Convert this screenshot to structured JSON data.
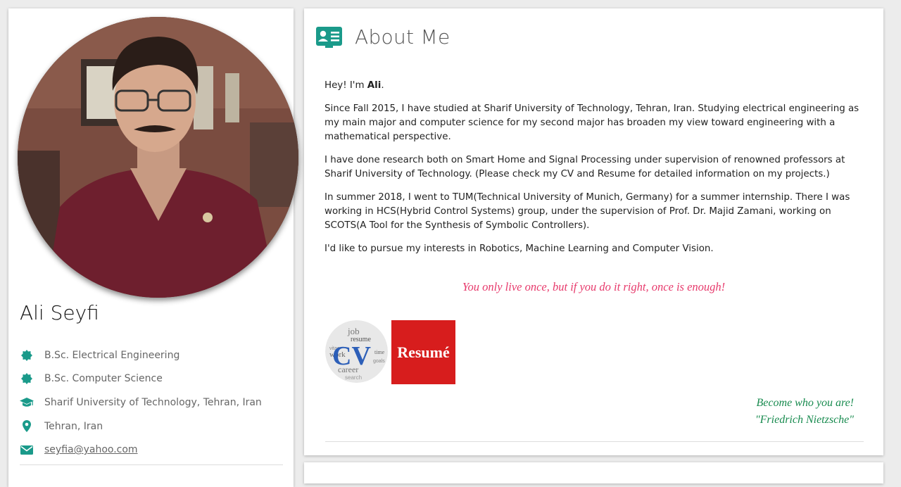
{
  "profile": {
    "name": "Ali Seyfi",
    "items": [
      {
        "icon": "badge-icon",
        "text": "B.Sc. Electrical Engineering"
      },
      {
        "icon": "badge-icon",
        "text": "B.Sc. Computer Science"
      },
      {
        "icon": "graduation-cap-icon",
        "text": "Sharif University of Technology, Tehran, Iran"
      },
      {
        "icon": "location-pin-icon",
        "text": "Tehran, Iran"
      },
      {
        "icon": "envelope-icon",
        "text": "seyfia@yahoo.com"
      }
    ]
  },
  "about": {
    "title": "About Me",
    "greeting_prefix": "Hey! I'm ",
    "greeting_name": "Ali",
    "greeting_suffix": ".",
    "paragraphs": [
      "Since Fall 2015, I have studied at Sharif University of Technology, Tehran, Iran. Studying electrical engineering as my main major and computer science for my second major has broaden my view toward engineering with a mathematical perspective.",
      "I have done research both on Smart Home and Signal Processing under supervision of renowned professors at Sharif University of Technology. (Please check my CV and Resume for detailed information on my projects.)",
      "In summer 2018, I went to TUM(Technical University of Munich, Germany) for a summer internship. There I was working in HCS(Hybrid Control Systems) group, under the supervision of Prof. Dr. Majid Zamani, working on SCOTS(A Tool for the Synthesis of Symbolic Controllers).",
      "I'd like to pursue my interests in Robotics, Machine Learning and Computer Vision."
    ],
    "quote": "You only live once, but if you do it right, once is enough!",
    "cv_label": "CV",
    "cv_words": [
      "job",
      "resume",
      "vitae",
      "work",
      "time",
      "career",
      "goals",
      "search"
    ],
    "resume_label": "Resumé",
    "nietzsche_quote": "Become who you are!",
    "nietzsche_author": "\"Friedrich Nietzsche\""
  },
  "colors": {
    "accent": "#1a9a8a",
    "quote": "#e73a6c",
    "nietzsche": "#178a4e",
    "resume_bg": "#d71d1d"
  }
}
